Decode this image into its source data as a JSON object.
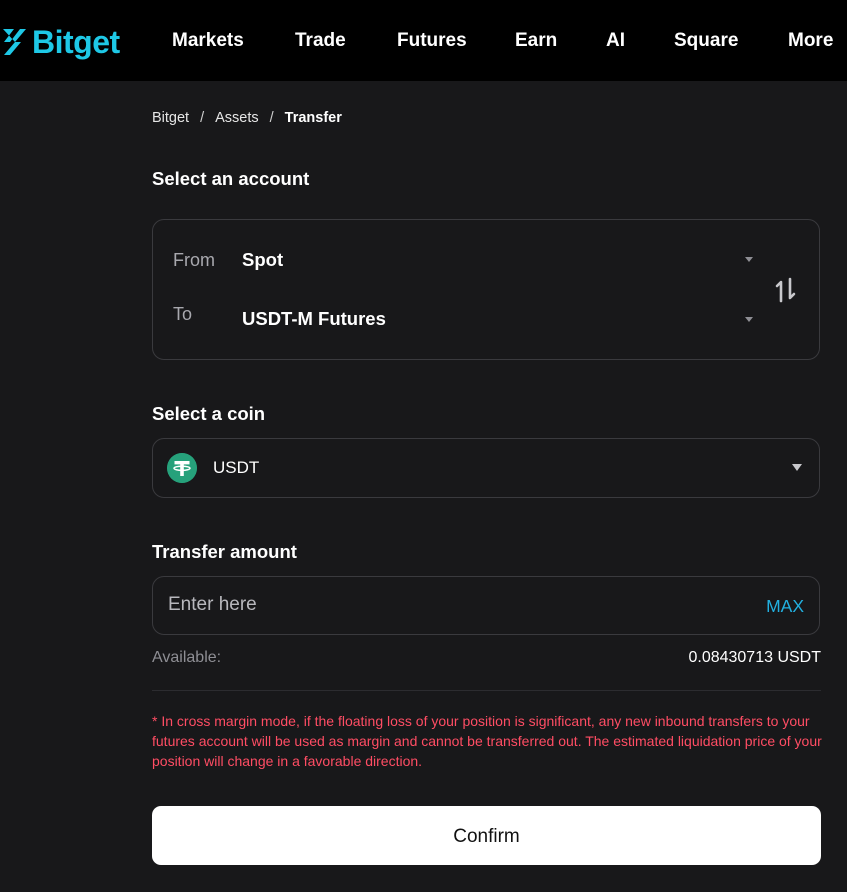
{
  "brand": {
    "name": "Bitget",
    "accent_color": "#1ec8e6",
    "logo_icon": "bitget-logo-icon"
  },
  "nav": {
    "items": [
      {
        "label": "Markets"
      },
      {
        "label": "Trade"
      },
      {
        "label": "Futures"
      },
      {
        "label": "Earn"
      },
      {
        "label": "AI"
      },
      {
        "label": "Square"
      },
      {
        "label": "More"
      }
    ]
  },
  "breadcrumb": {
    "items": [
      "Bitget",
      "Assets",
      "Transfer"
    ],
    "separator": "/"
  },
  "account_section": {
    "title": "Select an account",
    "from_label": "From",
    "from_value": "Spot",
    "to_label": "To",
    "to_value": "USDT-M Futures",
    "swap_icon": "swap-vertical-icon"
  },
  "coin_section": {
    "title": "Select a coin",
    "coin": "USDT",
    "coin_icon": "tether-icon",
    "coin_color": "#26a17b"
  },
  "amount_section": {
    "title": "Transfer amount",
    "placeholder": "Enter here",
    "max_label": "MAX",
    "available_label": "Available:",
    "available_value": "0.08430713 USDT"
  },
  "warning": {
    "text": "* In cross margin mode, if the floating loss of your position is significant, any new inbound transfers to your futures account will be used as margin and cannot be transferred out. The estimated liquidation price of your position will change in a favorable direction.",
    "color": "#ff4d64"
  },
  "confirm": {
    "label": "Confirm"
  }
}
